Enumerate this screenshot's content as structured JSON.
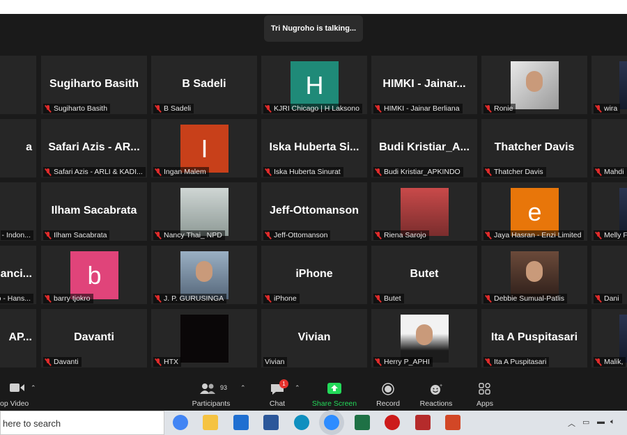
{
  "talking": "Tri Nugroho is talking...",
  "tiles": [
    {
      "name": "",
      "partial": true
    },
    {
      "big": "Sugiharto Basith",
      "name": "Sugiharto Basith"
    },
    {
      "big": "B Sadeli",
      "name": "B Sadeli"
    },
    {
      "avatar": "H",
      "color": "#1f8a78",
      "name": "KJRI Chicago | H Laksono"
    },
    {
      "big": "HIMKI - Jainar...",
      "name": "HIMKI - Jainar Berliana"
    },
    {
      "photo": "light",
      "name": "Ronie"
    },
    {
      "photo": "dark",
      "name": "wira"
    },
    {
      "big": "a",
      "name": "",
      "partial": true
    },
    {
      "big": "Safari Azis - AR...",
      "name": "Safari Azis - ARLI & KADI..."
    },
    {
      "avatar": "I",
      "color": "#c8401a",
      "name": "Ingan Malem"
    },
    {
      "big": "Iska Huberta Si...",
      "name": "Iska Huberta Sinurat"
    },
    {
      "big": "Budi Kristiar_A...",
      "name": "Budi Kristiar_APKINDO"
    },
    {
      "big": "Thatcher Davis",
      "name": "Thatcher Davis"
    },
    {
      "name": "Mahdi"
    },
    {
      "name": "- Indon...",
      "partial": true
    },
    {
      "big": "Ilham Sacabrata",
      "name": "Ilham Sacabrata"
    },
    {
      "photo": "room",
      "name": "Nancy Thai_ NPD"
    },
    {
      "big": "Jeff-Ottomanson",
      "name": "Jeff-Ottomanson"
    },
    {
      "photo": "city",
      "name": "Riena Sarojo"
    },
    {
      "avatar": "e",
      "color": "#e8760a",
      "name": "Jaya Hasran - Enzi Limited"
    },
    {
      "photo": "dark",
      "name": "Melly F"
    },
    {
      "big": "anci...",
      "name": "o - Hans...",
      "partial": true
    },
    {
      "avatar": "b",
      "color": "#e0447a",
      "name": "barry tjokro"
    },
    {
      "photo": "helmet",
      "name": "J. P. GURUSINGA"
    },
    {
      "big": "iPhone",
      "name": "iPhone"
    },
    {
      "big": "Butet",
      "name": "Butet"
    },
    {
      "photo": "woman",
      "name": "Debbie Sumual-Patlis"
    },
    {
      "name": "Dani"
    },
    {
      "big": "AP...",
      "name": "",
      "partial": true
    },
    {
      "big": "Davanti",
      "name": "Davanti"
    },
    {
      "photo": "black",
      "name": "HTX"
    },
    {
      "big": "Vivian",
      "name": "Vivian",
      "nomute": true
    },
    {
      "photo": "man",
      "name": "Herry P_APHI"
    },
    {
      "big": "Ita A Puspitasari",
      "name": "Ita A Puspitasari"
    },
    {
      "photo": "dark",
      "name": "Malik,"
    }
  ],
  "toolbar": {
    "video_label": "op Video",
    "participants_count": "93",
    "participants_label": "Participants",
    "chat_badge": "1",
    "chat_label": "Chat",
    "share_label": "Share Screen",
    "record_label": "Record",
    "reactions_label": "Reactions",
    "apps_label": "Apps"
  },
  "taskbar": {
    "search_placeholder": "here to search",
    "apps": [
      {
        "name": "chrome-icon",
        "color": "#4285f4"
      },
      {
        "name": "file-explorer-icon",
        "color": "#f5c342"
      },
      {
        "name": "mail-icon",
        "color": "#1f6fd1"
      },
      {
        "name": "word-icon",
        "color": "#2b579a"
      },
      {
        "name": "edge-icon",
        "color": "#0f8fbf"
      },
      {
        "name": "zoom-icon",
        "color": "#2d8cff"
      },
      {
        "name": "excel-icon",
        "color": "#1e7145"
      },
      {
        "name": "opera-icon",
        "color": "#cc1b1b"
      },
      {
        "name": "app-icon",
        "color": "#b52b2b"
      },
      {
        "name": "powerpoint-icon",
        "color": "#d24726"
      }
    ]
  },
  "colors": {
    "share_green": "#23d959",
    "mute_red": "#e02b2b",
    "badge_red": "#e5322d"
  }
}
